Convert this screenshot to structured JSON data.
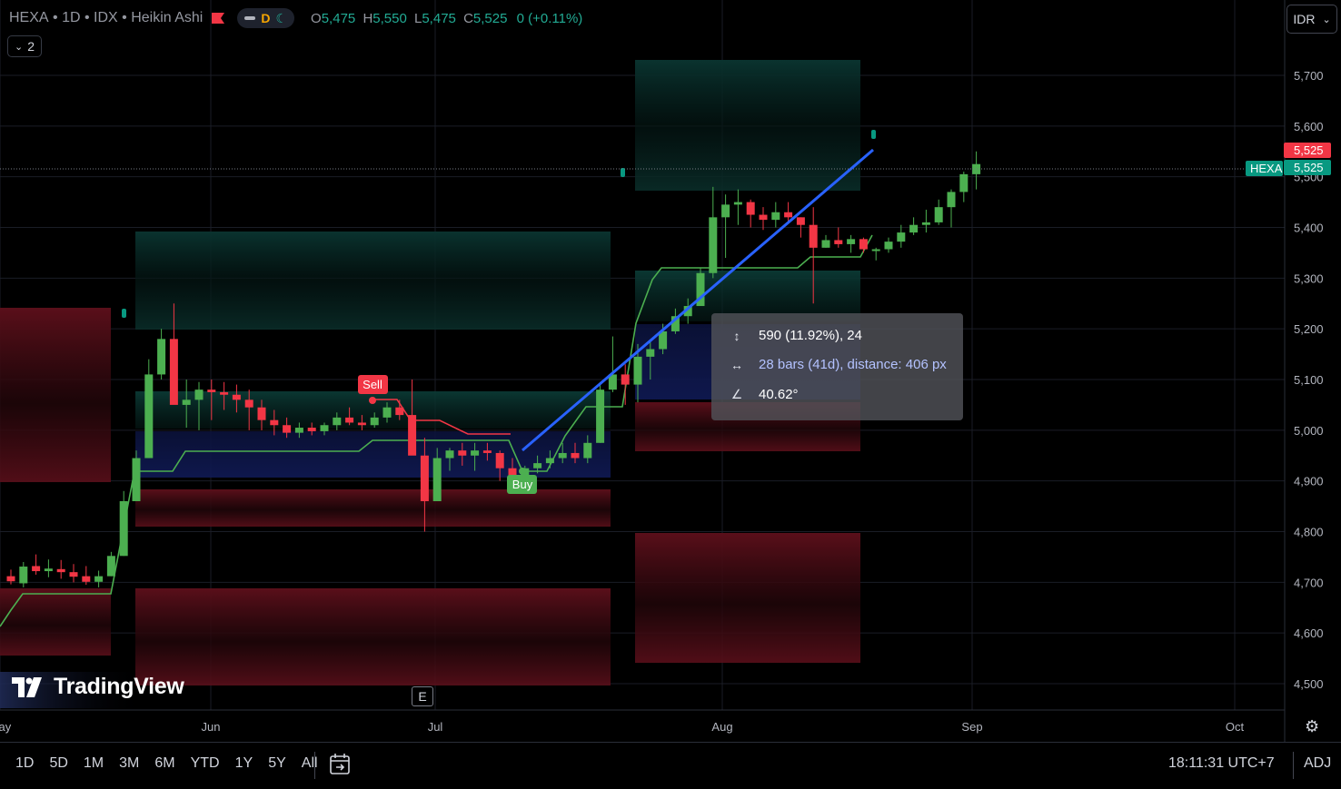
{
  "header": {
    "symbol": "HEXA",
    "interval": "1D",
    "exchange": "IDX",
    "chart_style": "Heikin Ashi",
    "session_letter": "D",
    "ohlc": {
      "o_label": "O",
      "o": "5,475",
      "h_label": "H",
      "h": "5,550",
      "l_label": "L",
      "l": "5,475",
      "c_label": "C",
      "c": "5,525",
      "change": "0 (+0.11%)"
    },
    "indicator_count": "2",
    "currency": "IDR"
  },
  "price_axis": {
    "ticks": [
      "5,700",
      "5,600",
      "5,500",
      "5,400",
      "5,300",
      "5,200",
      "5,100",
      "5,000",
      "4,900",
      "4,800",
      "4,700",
      "4,600",
      "4,500"
    ],
    "last_price_label": "5,525",
    "symbol_badge": "HEXA",
    "symbol_price": "5,525"
  },
  "time_axis": {
    "ticks": [
      "May",
      "Jun",
      "Jul",
      "Aug",
      "Sep",
      "Oct"
    ]
  },
  "signals": {
    "sell": "Sell",
    "buy": "Buy"
  },
  "measure_tooltip": {
    "price_range": "590 (11.92%), 24",
    "bars_range": "28 bars (41d), distance: 406 px",
    "angle": "40.62°"
  },
  "logo_text": "TradingView",
  "earnings_marker": "E",
  "bottom_bar": {
    "ranges": [
      "1D",
      "5D",
      "1M",
      "3M",
      "6M",
      "YTD",
      "1Y",
      "5Y",
      "All"
    ],
    "clock": "18:11:31 UTC+7",
    "adj": "ADJ"
  },
  "colors": {
    "up": "#4caf50",
    "down": "#f23645",
    "trend": "#2962ff",
    "teal": "#089981"
  },
  "chart_data": {
    "type": "candlestick",
    "style": "Heikin Ashi",
    "y_range": [
      4450,
      5790
    ],
    "candles": [
      [
        4712,
        4725,
        4696,
        4702
      ],
      [
        4698,
        4740,
        4690,
        4731
      ],
      [
        4732,
        4755,
        4715,
        4722
      ],
      [
        4722,
        4745,
        4710,
        4727
      ],
      [
        4726,
        4744,
        4707,
        4720
      ],
      [
        4720,
        4736,
        4700,
        4711
      ],
      [
        4712,
        4732,
        4695,
        4701
      ],
      [
        4701,
        4723,
        4690,
        4712
      ],
      [
        4712,
        4760,
        4712,
        4752
      ],
      [
        4752,
        4880,
        4752,
        4860
      ],
      [
        4860,
        4960,
        4860,
        4945
      ],
      [
        4945,
        5140,
        4945,
        5110
      ],
      [
        5110,
        5200,
        5100,
        5180
      ],
      [
        5180,
        5250,
        5100,
        5050
      ],
      [
        5050,
        5100,
        5005,
        5060
      ],
      [
        5060,
        5095,
        5000,
        5080
      ],
      [
        5080,
        5100,
        5020,
        5075
      ],
      [
        5075,
        5095,
        5040,
        5070
      ],
      [
        5070,
        5090,
        5035,
        5060
      ],
      [
        5060,
        5080,
        5000,
        5045
      ],
      [
        5045,
        5060,
        5000,
        5020
      ],
      [
        5020,
        5040,
        4990,
        5010
      ],
      [
        5010,
        5025,
        4985,
        4995
      ],
      [
        4995,
        5015,
        4985,
        5005
      ],
      [
        5005,
        5015,
        4990,
        4998
      ],
      [
        4998,
        5015,
        4990,
        5010
      ],
      [
        5010,
        5035,
        5000,
        5025
      ],
      [
        5025,
        5045,
        5010,
        5015
      ],
      [
        5015,
        5030,
        5000,
        5010
      ],
      [
        5010,
        5035,
        5005,
        5025
      ],
      [
        5025,
        5055,
        5015,
        5045
      ],
      [
        5045,
        5060,
        5020,
        5030
      ],
      [
        5030,
        5100,
        4990,
        4950
      ],
      [
        4950,
        4985,
        4800,
        4860
      ],
      [
        4860,
        4965,
        4895,
        4945
      ],
      [
        4945,
        4965,
        4920,
        4960
      ],
      [
        4960,
        4975,
        4930,
        4950
      ],
      [
        4950,
        4975,
        4920,
        4960
      ],
      [
        4960,
        4975,
        4940,
        4955
      ],
      [
        4955,
        4960,
        4900,
        4925
      ],
      [
        4925,
        4945,
        4895,
        4900
      ],
      [
        4900,
        4930,
        4900,
        4925
      ],
      [
        4925,
        4950,
        4915,
        4935
      ],
      [
        4935,
        4960,
        4925,
        4945
      ],
      [
        4945,
        4975,
        4935,
        4955
      ],
      [
        4955,
        4975,
        4935,
        4945
      ],
      [
        4945,
        4990,
        4935,
        4975
      ],
      [
        4975,
        5095,
        4975,
        5080
      ],
      [
        5080,
        5185,
        5075,
        5110
      ],
      [
        5110,
        5130,
        5050,
        5090
      ],
      [
        5090,
        5170,
        5055,
        5145
      ],
      [
        5145,
        5175,
        5100,
        5160
      ],
      [
        5160,
        5210,
        5150,
        5195
      ],
      [
        5195,
        5240,
        5190,
        5225
      ],
      [
        5225,
        5260,
        5210,
        5245
      ],
      [
        5245,
        5320,
        5245,
        5310
      ],
      [
        5310,
        5480,
        5300,
        5420
      ],
      [
        5420,
        5465,
        5340,
        5445
      ],
      [
        5445,
        5475,
        5405,
        5450
      ],
      [
        5450,
        5455,
        5400,
        5425
      ],
      [
        5425,
        5440,
        5395,
        5415
      ],
      [
        5415,
        5450,
        5400,
        5430
      ],
      [
        5430,
        5450,
        5410,
        5420
      ],
      [
        5420,
        5420,
        5380,
        5405
      ],
      [
        5405,
        5440,
        5250,
        5360
      ],
      [
        5360,
        5385,
        5360,
        5375
      ],
      [
        5375,
        5400,
        5360,
        5367
      ],
      [
        5367,
        5385,
        5350,
        5377
      ],
      [
        5377,
        5380,
        5350,
        5357
      ],
      [
        5357,
        5360,
        5335,
        5357
      ],
      [
        5357,
        5380,
        5350,
        5372
      ],
      [
        5372,
        5405,
        5360,
        5390
      ],
      [
        5390,
        5420,
        5385,
        5405
      ],
      [
        5405,
        5435,
        5390,
        5410
      ],
      [
        5410,
        5455,
        5405,
        5440
      ],
      [
        5440,
        5475,
        5400,
        5470
      ],
      [
        5470,
        5510,
        5450,
        5505
      ],
      [
        5505,
        5550,
        5475,
        5525
      ]
    ],
    "start_date": "",
    "trend_line": {
      "from_price": 4960,
      "to_price": 5550,
      "bars": 28
    },
    "time_ticks": [
      "May",
      "Jun",
      "Jul",
      "Aug",
      "Sep",
      "Oct"
    ],
    "price_ticks": [
      5700,
      5600,
      5500,
      5400,
      5300,
      5200,
      5100,
      5000,
      4900,
      4800,
      4700,
      4600,
      4500
    ]
  }
}
